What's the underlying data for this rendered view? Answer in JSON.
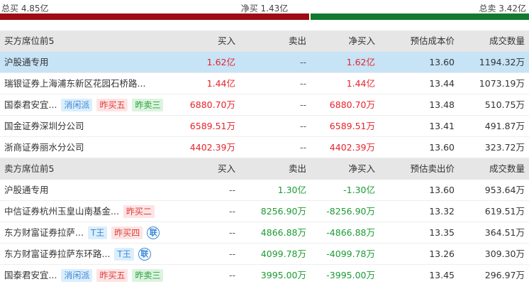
{
  "summary": {
    "total_buy": "总买 4.85亿",
    "net_buy": "净买 1.43亿",
    "total_sell": "总卖 3.42亿",
    "buy_ratio": 0.585
  },
  "buy_section": {
    "header": {
      "title": "买方席位前5",
      "buy": "买入",
      "sell": "卖出",
      "net": "净买入",
      "price": "预估成本价",
      "volume": "成交数量"
    },
    "rows": [
      {
        "name": "沪股通专用",
        "tags": [],
        "buy": "1.62亿",
        "sell": "--",
        "net": "1.62亿",
        "price": "13.60",
        "volume": "1194.32万"
      },
      {
        "name": "瑞银证券上海浦东新区花园石桥路...",
        "tags": [],
        "buy": "1.44亿",
        "sell": "--",
        "net": "1.44亿",
        "price": "13.44",
        "volume": "1073.19万"
      },
      {
        "name": "国泰君安宜...",
        "tags": [
          {
            "text": "消闲派",
            "style": "blue"
          },
          {
            "text": "昨买五",
            "style": "pink"
          },
          {
            "text": "昨卖三",
            "style": "lgreen"
          }
        ],
        "buy": "6880.70万",
        "sell": "--",
        "net": "6880.70万",
        "price": "13.48",
        "volume": "510.75万"
      },
      {
        "name": "国金证券深圳分公司",
        "tags": [],
        "buy": "6589.51万",
        "sell": "--",
        "net": "6589.51万",
        "price": "13.41",
        "volume": "491.87万"
      },
      {
        "name": "浙商证券丽水分公司",
        "tags": [],
        "buy": "4402.39万",
        "sell": "--",
        "net": "4402.39万",
        "price": "13.60",
        "volume": "323.72万"
      }
    ]
  },
  "sell_section": {
    "header": {
      "title": "卖方席位前5",
      "buy": "买入",
      "sell": "卖出",
      "net": "净买入",
      "price": "预估卖出价",
      "volume": "成交数量"
    },
    "rows": [
      {
        "name": "沪股通专用",
        "tags": [],
        "buy": "--",
        "sell": "1.30亿",
        "net": "-1.30亿",
        "price": "13.60",
        "volume": "953.64万"
      },
      {
        "name": "中信证券杭州玉皇山南基金...",
        "tags": [
          {
            "text": "昨买二",
            "style": "pink"
          }
        ],
        "buy": "--",
        "sell": "8256.90万",
        "net": "-8256.90万",
        "price": "13.32",
        "volume": "619.51万"
      },
      {
        "name": "东方财富证券拉萨...",
        "tags": [
          {
            "text": "T王",
            "style": "blue"
          },
          {
            "text": "昨买四",
            "style": "pink"
          },
          {
            "text": "联",
            "style": "lian"
          }
        ],
        "buy": "--",
        "sell": "4866.88万",
        "net": "-4866.88万",
        "price": "13.35",
        "volume": "364.51万"
      },
      {
        "name": "东方财富证券拉萨东环路...",
        "tags": [
          {
            "text": "T王",
            "style": "blue"
          },
          {
            "text": "联",
            "style": "lian"
          }
        ],
        "buy": "--",
        "sell": "4099.78万",
        "net": "-4099.78万",
        "price": "13.26",
        "volume": "309.30万"
      },
      {
        "name": "国泰君安宜...",
        "tags": [
          {
            "text": "消闲派",
            "style": "blue"
          },
          {
            "text": "昨买五",
            "style": "pink"
          },
          {
            "text": "昨卖三",
            "style": "lgreen"
          }
        ],
        "buy": "--",
        "sell": "3995.00万",
        "net": "-3995.00万",
        "price": "13.45",
        "volume": "296.97万"
      }
    ]
  },
  "colors": {
    "buy_bar": "#9d0d13",
    "sell_bar": "#127a2e",
    "up": "#e8232a",
    "down": "#1b9b33",
    "highlight": "#c7e3f6"
  }
}
